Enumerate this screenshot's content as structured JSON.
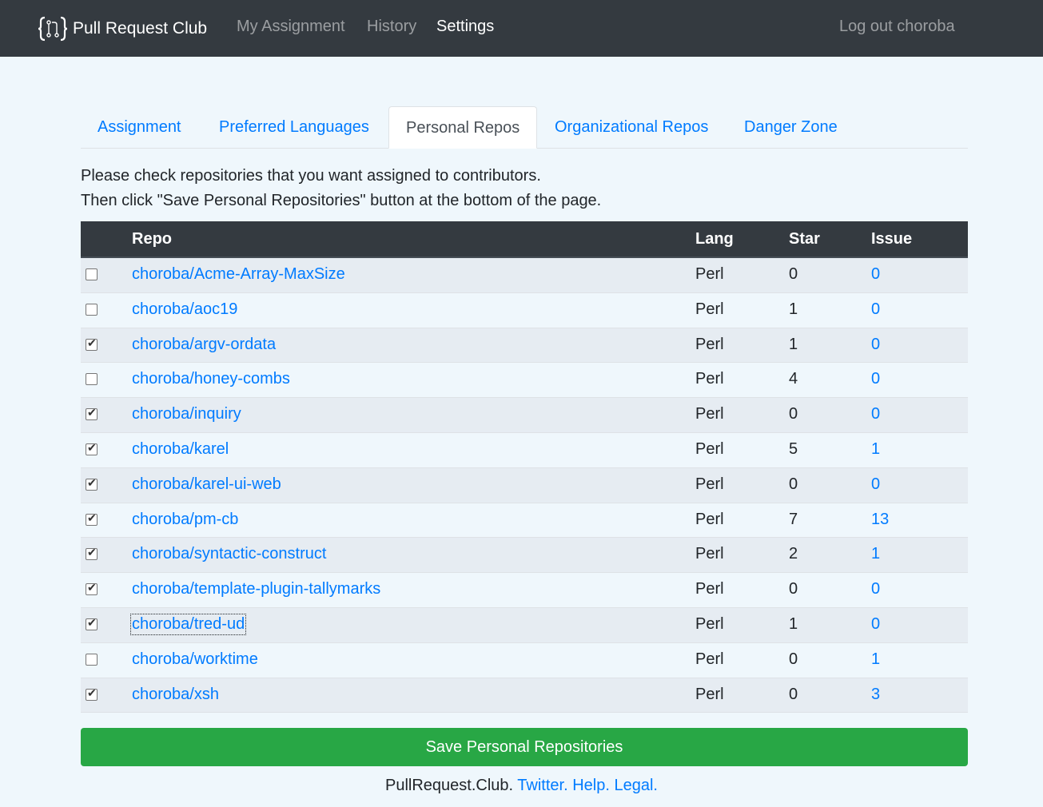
{
  "nav": {
    "brand": "Pull Request Club",
    "links": [
      "My Assignment",
      "History",
      "Settings"
    ],
    "active": "Settings",
    "logout": "Log out choroba"
  },
  "tabs": [
    "Assignment",
    "Preferred Languages",
    "Personal Repos",
    "Organizational Repos",
    "Danger Zone"
  ],
  "active_tab": "Personal Repos",
  "intro": {
    "line1": "Please check repositories that you want assigned to contributors.",
    "line2": "Then click \"Save Personal Repositories\" button at the bottom of the page."
  },
  "table": {
    "headers": {
      "repo": "Repo",
      "lang": "Lang",
      "star": "Star",
      "issue": "Issue"
    },
    "rows": [
      {
        "repo": "choroba/Acme-Array-MaxSize",
        "lang": "Perl",
        "star": "0",
        "issue": "0",
        "checked": false
      },
      {
        "repo": "choroba/aoc19",
        "lang": "Perl",
        "star": "1",
        "issue": "0",
        "checked": false
      },
      {
        "repo": "choroba/argv-ordata",
        "lang": "Perl",
        "star": "1",
        "issue": "0",
        "checked": true
      },
      {
        "repo": "choroba/honey-combs",
        "lang": "Perl",
        "star": "4",
        "issue": "0",
        "checked": false
      },
      {
        "repo": "choroba/inquiry",
        "lang": "Perl",
        "star": "0",
        "issue": "0",
        "checked": true
      },
      {
        "repo": "choroba/karel",
        "lang": "Perl",
        "star": "5",
        "issue": "1",
        "checked": true
      },
      {
        "repo": "choroba/karel-ui-web",
        "lang": "Perl",
        "star": "0",
        "issue": "0",
        "checked": true
      },
      {
        "repo": "choroba/pm-cb",
        "lang": "Perl",
        "star": "7",
        "issue": "13",
        "checked": true
      },
      {
        "repo": "choroba/syntactic-construct",
        "lang": "Perl",
        "star": "2",
        "issue": "1",
        "checked": true
      },
      {
        "repo": "choroba/template-plugin-tallymarks",
        "lang": "Perl",
        "star": "0",
        "issue": "0",
        "checked": true
      },
      {
        "repo": "choroba/tred-ud",
        "lang": "Perl",
        "star": "1",
        "issue": "0",
        "checked": true,
        "focused": true
      },
      {
        "repo": "choroba/worktime",
        "lang": "Perl",
        "star": "0",
        "issue": "1",
        "checked": false
      },
      {
        "repo": "choroba/xsh",
        "lang": "Perl",
        "star": "0",
        "issue": "3",
        "checked": true
      }
    ]
  },
  "save_button": "Save Personal Repositories",
  "footer": {
    "site": "PullRequest.Club.",
    "links": [
      "Twitter.",
      "Help.",
      "Legal."
    ]
  },
  "colors": {
    "navbar": "#343a40",
    "link": "#007bff",
    "save": "#28a745",
    "page_bg": "#eff7fc"
  }
}
